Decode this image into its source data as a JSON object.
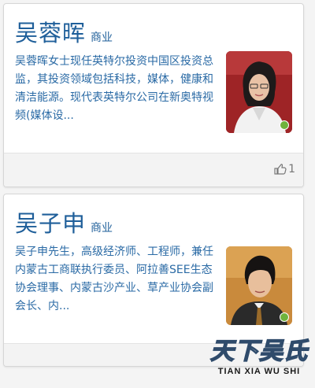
{
  "cards": [
    {
      "name": "吴蓉晖",
      "category": "商业",
      "bio": "吴蓉晖女士现任英特尔投资中国区投资总监，其投资领域包括科技，媒体，健康和清洁能源。现代表英特尔公司在新奥特视频(媒体设...",
      "likes": "1"
    },
    {
      "name": "吴子申",
      "category": "商业",
      "bio": "吴子申先生，高级经济师、工程师，兼任内蒙古工商联执行委员、阿拉善SEE生态协会理事、内蒙古沙产业、草产业协会副会长、内..."
    }
  ],
  "watermark": {
    "title": "天下吴氏",
    "subtitle": "TIAN XIA WU SHI"
  },
  "colors": {
    "name": "#1f5f9a",
    "bio": "#2a6aa5",
    "online": "#6fb33c"
  }
}
